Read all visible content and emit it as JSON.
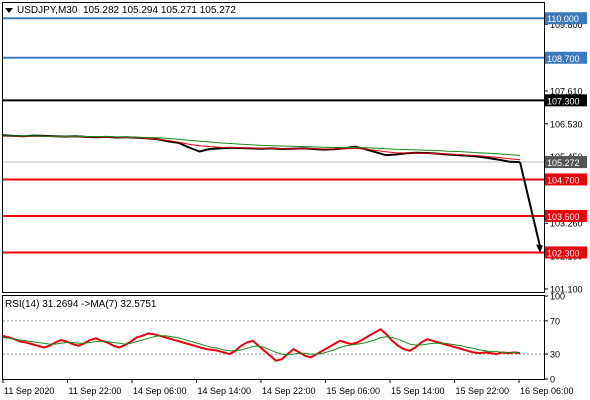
{
  "header": {
    "symbol": "USDJPY,M30",
    "ohlc": "105.282 105.294 105.271 105.272"
  },
  "rsi_header": {
    "label": "RSI(14) 31.2694 ->MA(7) 32.5751"
  },
  "colors": {
    "level_blue": "#3a7bbf",
    "level_black": "#000000",
    "level_red": "#e8000b",
    "price": "#000000",
    "ma_red": "#e8000b",
    "ma_green": "#1a8a1a",
    "rsi": "#e8000b",
    "rsi_ma": "#1a8a1a",
    "arrow": "#000000"
  },
  "chart_data": [
    {
      "type": "line",
      "pane": "price",
      "ylim": [
        101.0,
        110.5
      ],
      "y_tick_labels": [
        "109.800",
        "107.610",
        "106.530",
        "105.450",
        "104.700",
        "103.260",
        "102.180",
        "101.100"
      ],
      "y_ticks": [
        109.8,
        107.61,
        106.53,
        105.45,
        104.7,
        103.26,
        102.18,
        101.1
      ],
      "horizontal_levels": [
        {
          "value": 110.0,
          "label": "110.000",
          "color": "blue"
        },
        {
          "value": 108.7,
          "label": "108.700",
          "color": "blue"
        },
        {
          "value": 107.3,
          "label": "107.300",
          "color": "black"
        },
        {
          "value": 104.7,
          "label": "104.700",
          "color": "red"
        },
        {
          "value": 103.5,
          "label": "103.500",
          "color": "red"
        },
        {
          "value": 102.3,
          "label": "102.300",
          "color": "red"
        }
      ],
      "current_price": {
        "value": 105.272,
        "label": "105.272"
      },
      "x_labels": [
        "11 Sep 2020",
        "11 Sep 22:00",
        "14 Sep 06:00",
        "14 Sep 14:00",
        "14 Sep 22:00",
        "15 Sep 06:00",
        "15 Sep 14:00",
        "15 Sep 22:00",
        "16 Sep 06:00"
      ],
      "series": [
        {
          "values": [
            106.15,
            106.13,
            106.12,
            106.14,
            106.13,
            106.12,
            106.11,
            106.12,
            106.1,
            106.09,
            106.1,
            106.08,
            106.09,
            106.07,
            106.05,
            106.02,
            105.95,
            105.9,
            105.75,
            105.62,
            105.7,
            105.72,
            105.74,
            105.73,
            105.72,
            105.71,
            105.72,
            105.7,
            105.71,
            105.72,
            105.7,
            105.68,
            105.69,
            105.72,
            105.78,
            105.7,
            105.6,
            105.5,
            105.52,
            105.56,
            105.58,
            105.57,
            105.55,
            105.52,
            105.5,
            105.48,
            105.45,
            105.4,
            105.35,
            105.28,
            105.27
          ]
        },
        {
          "values": [
            106.12,
            106.12,
            106.12,
            106.12,
            106.12,
            106.11,
            106.11,
            106.11,
            106.1,
            106.1,
            106.09,
            106.09,
            106.08,
            106.07,
            106.05,
            106.02,
            105.98,
            105.92,
            105.86,
            105.81,
            105.78,
            105.76,
            105.75,
            105.74,
            105.73,
            105.72,
            105.72,
            105.71,
            105.71,
            105.71,
            105.71,
            105.7,
            105.7,
            105.71,
            105.72,
            105.7,
            105.66,
            105.61,
            105.58,
            105.57,
            105.57,
            105.56,
            105.55,
            105.54,
            105.52,
            105.5,
            105.48,
            105.45,
            105.42,
            105.38,
            105.35
          ]
        },
        {
          "values": [
            106.13,
            106.13,
            106.13,
            106.13,
            106.12,
            106.12,
            106.12,
            106.12,
            106.11,
            106.11,
            106.11,
            106.1,
            106.1,
            106.09,
            106.08,
            106.07,
            106.05,
            106.02,
            105.99,
            105.96,
            105.93,
            105.9,
            105.88,
            105.86,
            105.84,
            105.82,
            105.81,
            105.8,
            105.79,
            105.78,
            105.77,
            105.76,
            105.75,
            105.75,
            105.75,
            105.74,
            105.73,
            105.71,
            105.69,
            105.68,
            105.67,
            105.66,
            105.65,
            105.63,
            105.62,
            105.6,
            105.58,
            105.56,
            105.54,
            105.51,
            105.49
          ]
        }
      ],
      "projection": [
        105.272,
        102.3
      ]
    },
    {
      "type": "line",
      "pane": "rsi",
      "ylim": [
        0,
        100
      ],
      "y_tick_labels": [
        "100",
        "70",
        "30",
        "0"
      ],
      "y_ticks": [
        100,
        70,
        30,
        0
      ],
      "series": [
        {
          "values": [
            52,
            50,
            48,
            45,
            44,
            42,
            40,
            38,
            40,
            44,
            47,
            45,
            42,
            40,
            43,
            47,
            49,
            46,
            44,
            40,
            38,
            41,
            45,
            50,
            52,
            55,
            54,
            52,
            50,
            48,
            46,
            44,
            42,
            40,
            38,
            36,
            35,
            34,
            32,
            30,
            34,
            40,
            44,
            46,
            40,
            34,
            28,
            22,
            24,
            30,
            36,
            32,
            28,
            26,
            30,
            34,
            38,
            42,
            46,
            44,
            42,
            44,
            48,
            52,
            56,
            60,
            54,
            46,
            40,
            36,
            34,
            38,
            44,
            48,
            46,
            44,
            42,
            40,
            38,
            36,
            34,
            32,
            31,
            32,
            31,
            30,
            32,
            31,
            32,
            31
          ]
        },
        {
          "values": [
            50,
            49,
            48,
            47,
            46,
            45,
            44,
            43,
            42,
            42,
            43,
            44,
            44,
            43,
            43,
            44,
            45,
            45,
            45,
            44,
            43,
            42,
            43,
            45,
            47,
            49,
            51,
            52,
            52,
            51,
            50,
            48,
            46,
            44,
            42,
            40,
            38,
            37,
            35,
            34,
            34,
            35,
            37,
            39,
            40,
            38,
            35,
            32,
            30,
            29,
            30,
            31,
            31,
            30,
            30,
            31,
            33,
            35,
            38,
            40,
            41,
            42,
            43,
            45,
            47,
            50,
            51,
            50,
            48,
            45,
            42,
            41,
            41,
            42,
            43,
            43,
            43,
            42,
            41,
            40,
            38,
            37,
            35,
            34,
            33,
            33,
            32,
            32,
            32,
            32
          ]
        }
      ]
    }
  ]
}
